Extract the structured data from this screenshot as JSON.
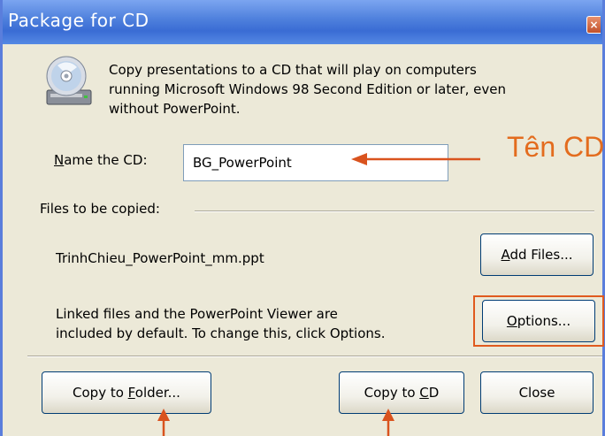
{
  "window": {
    "title": "Package for CD",
    "close_symbol": "×"
  },
  "intro": {
    "line1": "Copy presentations to a CD that will play on computers",
    "line2": "running Microsoft Windows 98 Second Edition or later, even",
    "line3": "without PowerPoint."
  },
  "name_cd": {
    "label_accel": "N",
    "label_rest": "ame the CD:",
    "value": "BG_PowerPoint"
  },
  "annotation": {
    "text": "Tên CD",
    "color": "#e36c1e"
  },
  "files": {
    "group_label": "Files to be copied:",
    "file_name": "TrinhChieu_PowerPoint_mm.ppt",
    "add_files_accel": "A",
    "add_files_rest": "dd Files..."
  },
  "linked": {
    "line1": "Linked files and the PowerPoint Viewer are",
    "line2": "included by default. To change this, click Options.",
    "options_accel": "O",
    "options_rest": "ptions..."
  },
  "footer": {
    "copy_folder_pre": "Copy to ",
    "copy_folder_accel": "F",
    "copy_folder_post": "older...",
    "copy_cd_pre": "Copy to ",
    "copy_cd_accel": "C",
    "copy_cd_post": "D",
    "close_label": "Close"
  },
  "colors": {
    "titlebar": "#3a6cd4",
    "dialog_bg": "#ece9d8",
    "highlight_border": "#e05a1e"
  },
  "icons": {
    "cd_icon": "cd-drive-icon",
    "close_icon": "close-icon"
  }
}
